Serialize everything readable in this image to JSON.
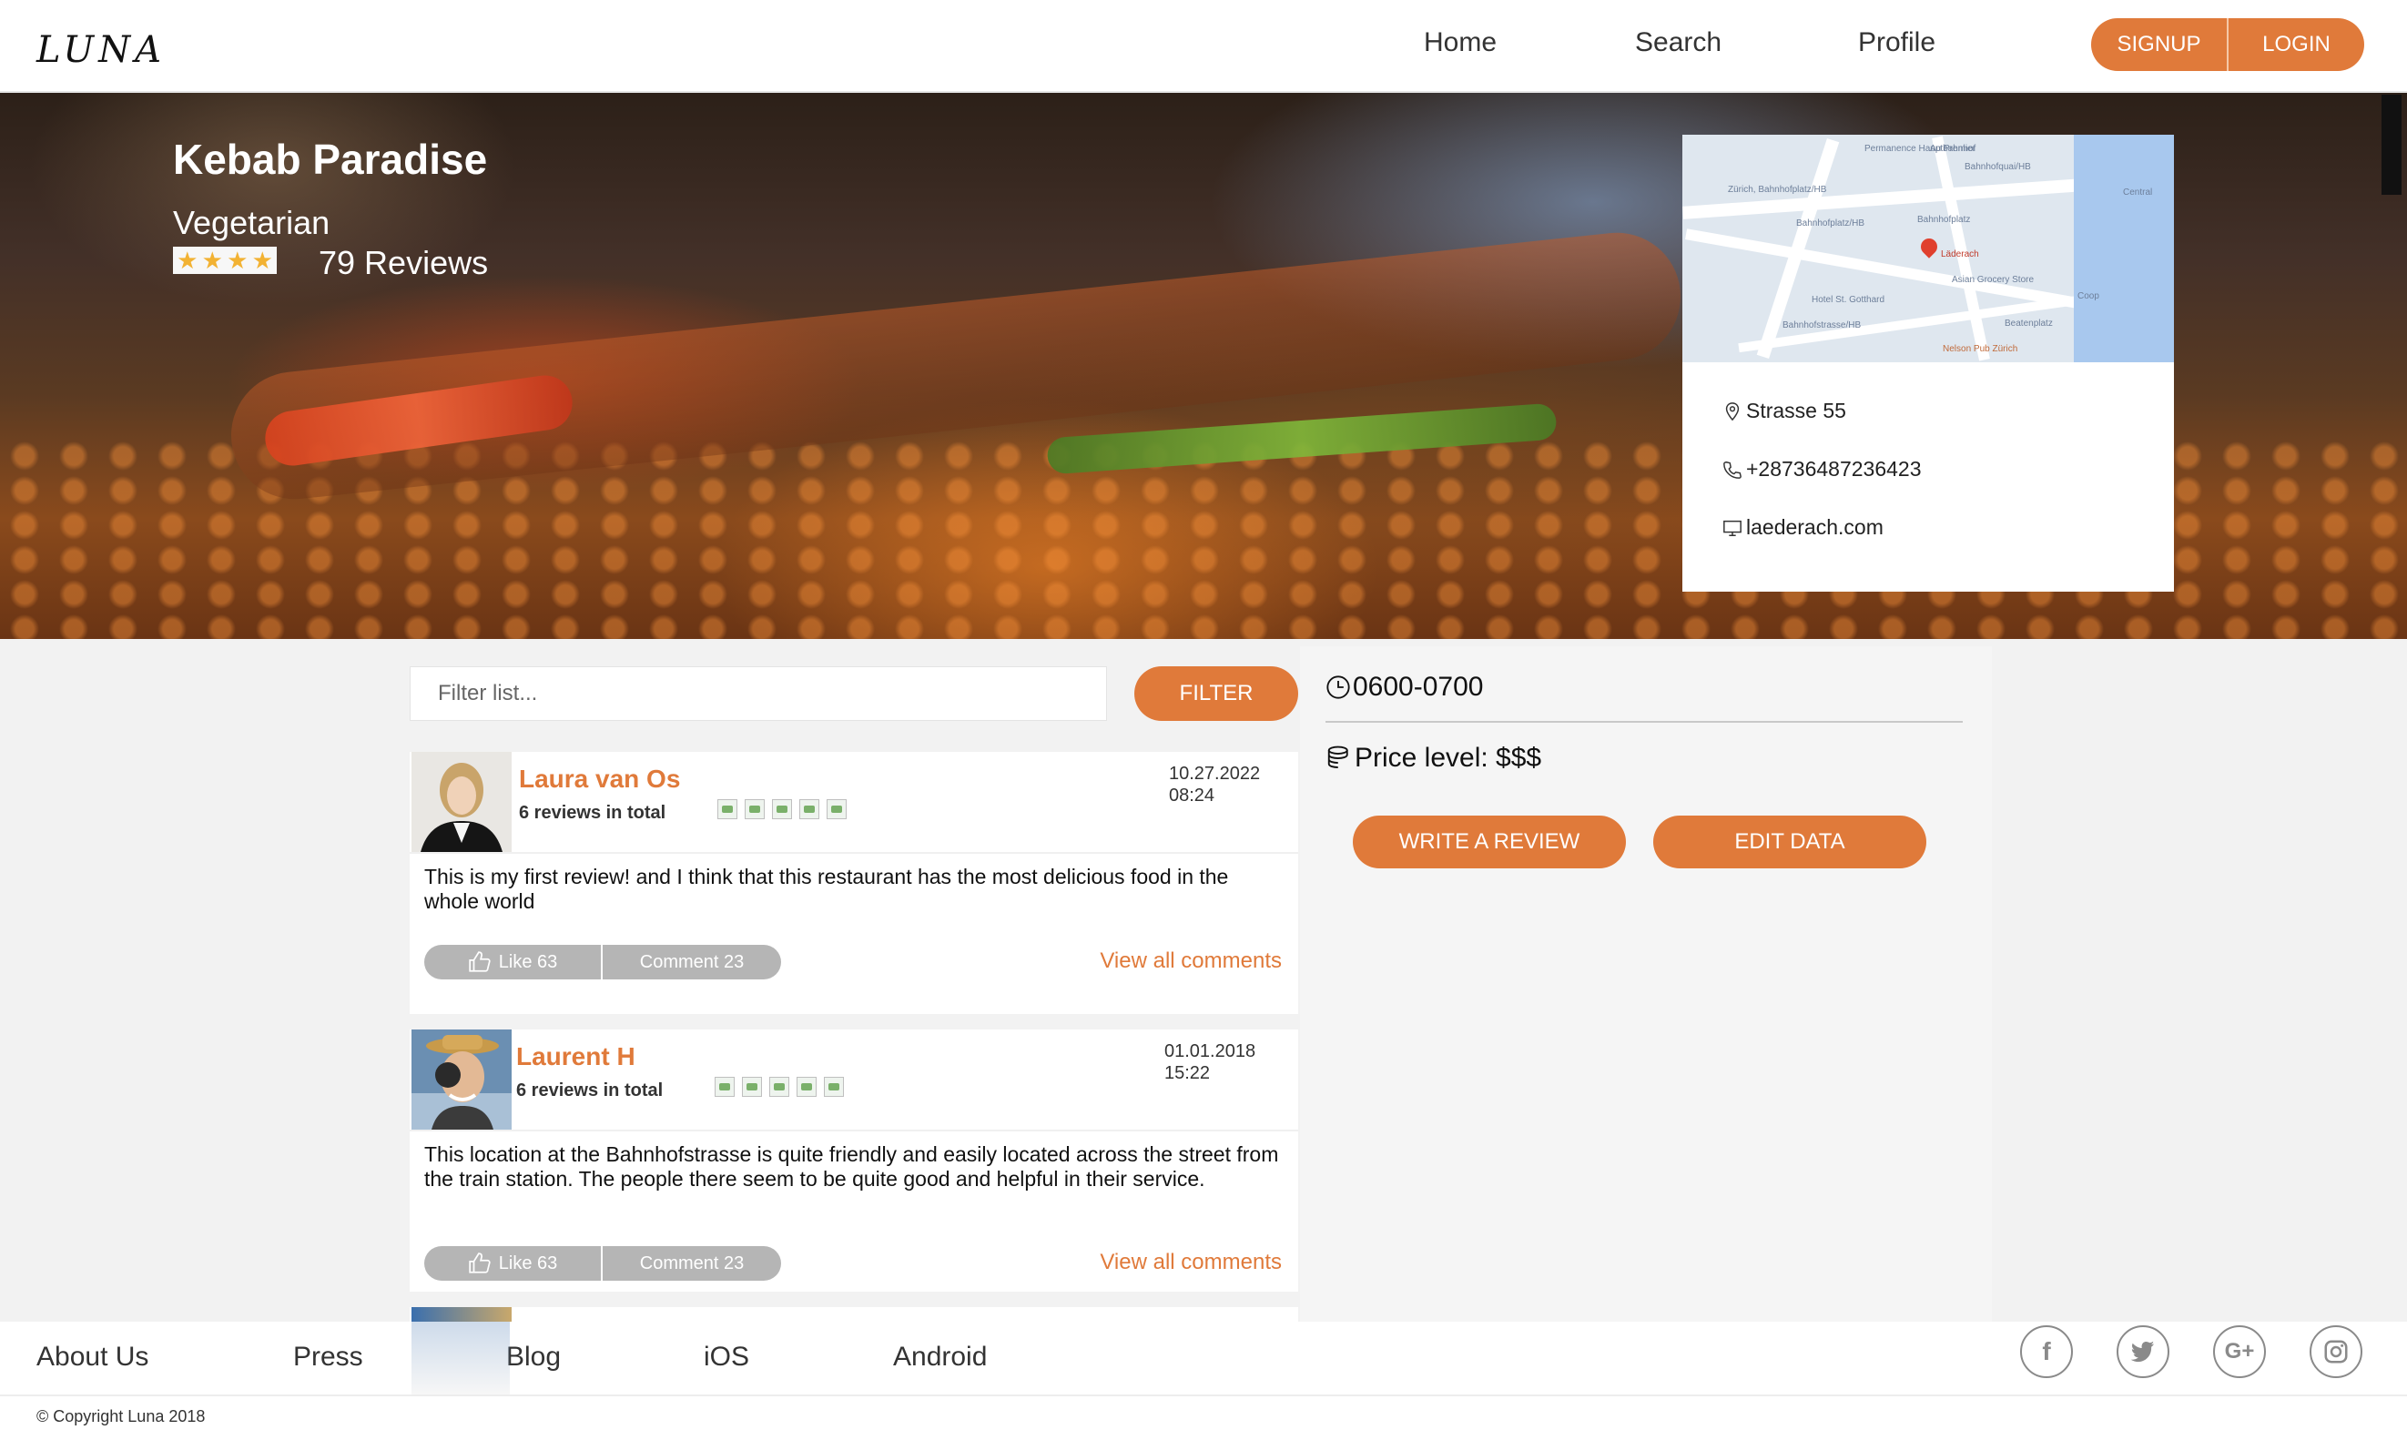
{
  "header": {
    "logo": "LUNA",
    "nav": [
      "Home",
      "Search",
      "Profile"
    ],
    "signup_label": "SIGNUP",
    "login_label": "LOGIN"
  },
  "business": {
    "name": "Kebab Paradise",
    "category": "Vegetarian",
    "rating_stars": 4,
    "reviews_label": "79 Reviews",
    "address": "Strasse 55",
    "phone": "+28736487236423",
    "website": "laederach.com",
    "map_labels": [
      "Permanence Hauptbahnhof",
      "Au Premier",
      "Bahnhofquai/HB",
      "Zürich, Bahnhofplatz/HB",
      "Bahnhofplatz/HB",
      "Bahnhofplatz",
      "Läderach",
      "Asian Grocery Store",
      "Coop",
      "Hotel St. Gotthard",
      "Bahnhofstrasse/HB",
      "Beatenplatz",
      "Nelson Pub Zürich",
      "Central"
    ]
  },
  "filter": {
    "placeholder": "Filter list...",
    "button_label": "FILTER"
  },
  "reviews": [
    {
      "name": "Laura van Os",
      "total": "6 reviews in total",
      "date": "10.27.2022",
      "time": "08:24",
      "text": "This is my first review! and I think that this restaurant has the most delicious food in the whole world",
      "like_label": "Like 63",
      "comment_label": "Comment 23",
      "view_all_label": "View all comments"
    },
    {
      "name": "Laurent H",
      "total": "6 reviews in total",
      "date": "01.01.2018",
      "time": "15:22",
      "text": "This location at the Bahnhofstrasse is quite friendly and easily located across the street from the train station. The people there seem to be quite good and helpful in their service.",
      "like_label": "Like 63",
      "comment_label": "Comment 23",
      "view_all_label": "View all comments"
    }
  ],
  "details": {
    "hours": "0600-0700",
    "price": "Price level: $$$",
    "write_review_label": "WRITE A REVIEW",
    "edit_data_label": "EDIT DATA"
  },
  "footer": {
    "links": [
      "About Us",
      "Press",
      "Blog",
      "iOS",
      "Android"
    ],
    "social": [
      "facebook-icon",
      "twitter-icon",
      "google-plus-icon",
      "instagram-icon"
    ],
    "copyright": "© Copyright Luna 2018"
  },
  "colors": {
    "accent": "#e07a3a",
    "panel": "#f5f5f5",
    "action_bar": "#b5b5b5"
  }
}
